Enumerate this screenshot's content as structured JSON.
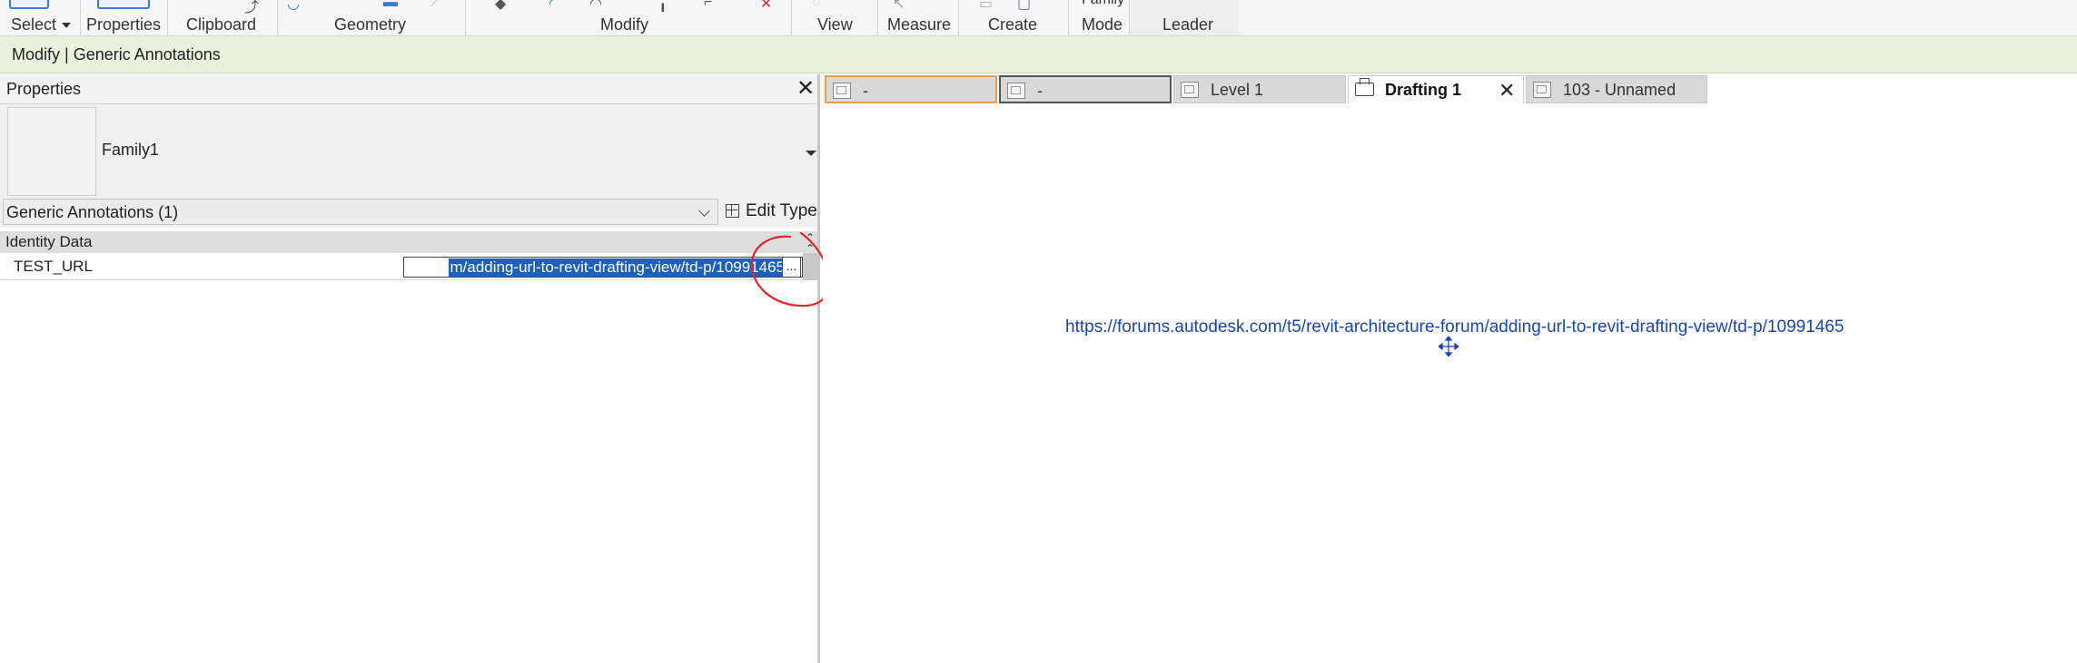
{
  "ribbon": {
    "select_label": "Select",
    "properties_label": "Properties",
    "clipboard_label": "Clipboard",
    "geometry_label": "Geometry",
    "modify_label": "Modify",
    "view_label": "View",
    "measure_label": "Measure",
    "create_label": "Create",
    "mode_label": "Mode",
    "family_label": "Family",
    "leader_label": "Leader"
  },
  "contextbar": {
    "text": "Modify | Generic Annotations"
  },
  "properties": {
    "title": "Properties",
    "family_name": "Family1",
    "selector_value": "Generic Annotations (1)",
    "edit_type_label": "Edit Type",
    "group_label": "Identity Data",
    "param_name": "TEST_URL",
    "param_value": "m/adding-url-to-revit-drafting-view/td-p/10991465",
    "ellipsis": "..."
  },
  "tabs": [
    {
      "label": "-"
    },
    {
      "label": "-"
    },
    {
      "label": "Level 1"
    },
    {
      "label": "Drafting 1"
    },
    {
      "label": "103 - Unnamed"
    }
  ],
  "canvas": {
    "url_text": "https://forums.autodesk.com/t5/revit-architecture-forum/adding-url-to-revit-drafting-view/td-p/10991465"
  },
  "colors": {
    "context_bar": "#e8f2dc",
    "selection_highlight": "#1b5fbf",
    "url_text": "#1a45b8",
    "annotation_circle": "#e0262b",
    "tab_active_border": "#e8a048"
  }
}
